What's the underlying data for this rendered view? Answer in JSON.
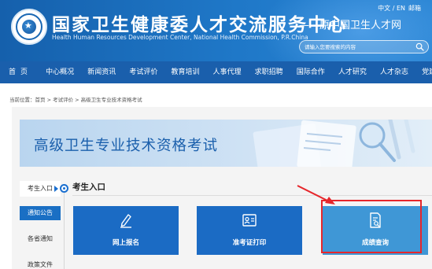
{
  "header": {
    "title": "国家卫生健康委人才交流服务中心",
    "subtitle": "——原中国卫生人才网",
    "english": "Health Human Resources Development Center, National Health Commission, P.R.China",
    "lang": "中文 / EN",
    "mail": "邮箱",
    "search_placeholder": "请输入您要搜索的内容"
  },
  "nav": {
    "items": [
      "首页",
      "中心概况",
      "新闻资讯",
      "考试评价",
      "教育培训",
      "人事代理",
      "求职招聘",
      "国际合作",
      "人才研究",
      "人才杂志",
      "党建工作"
    ]
  },
  "breadcrumb": "当前位置：首页 > 考试评价 > 高级卫生专业技术资格考试",
  "banner": {
    "title": "高级卫生专业技术资格考试"
  },
  "side_menu": {
    "active": "考生入口",
    "button": "通知公告",
    "links": [
      "各省通知",
      "政策文件"
    ]
  },
  "section": {
    "title": "考生入口"
  },
  "cards": [
    {
      "label": "网上报名",
      "icon": "pen-icon"
    },
    {
      "label": "准考证打印",
      "icon": "id-card-icon"
    },
    {
      "label": "成绩查询",
      "icon": "document-search-icon"
    }
  ],
  "colors": {
    "header_blue": "#1560ac",
    "nav_blue": "#1a5fac",
    "card_blue": "#1b6bc4",
    "card_light_blue": "#3f97d6",
    "highlight_red": "#e6262b"
  }
}
